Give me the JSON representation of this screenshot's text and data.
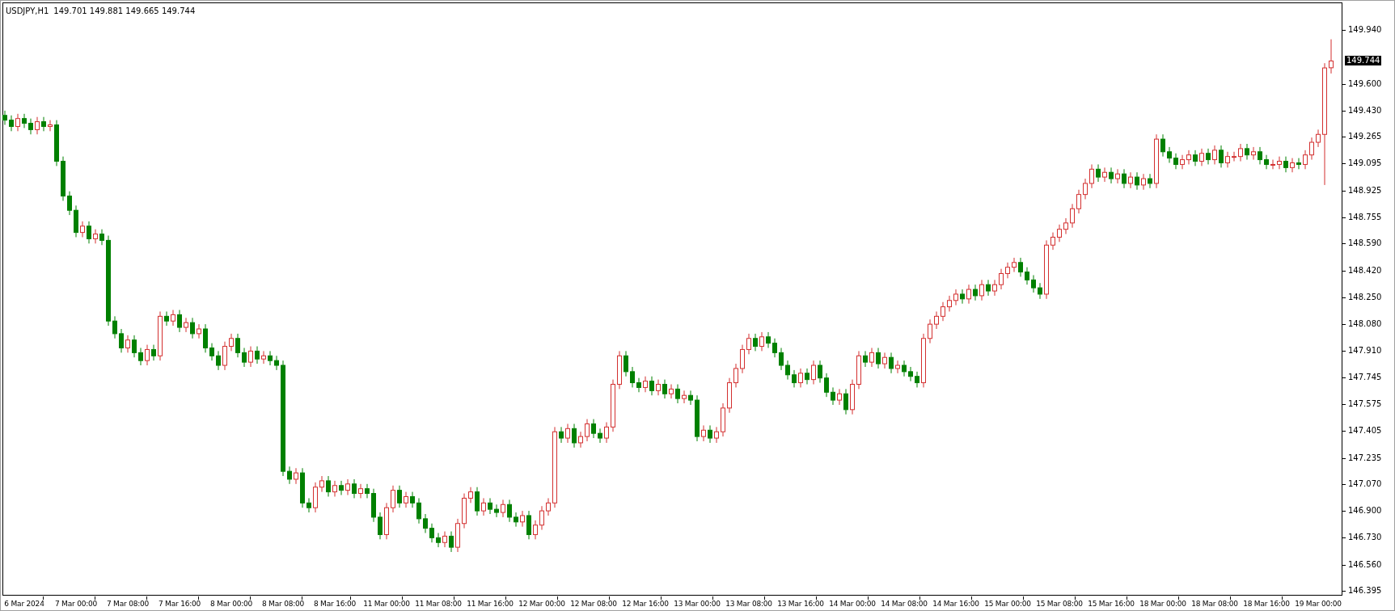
{
  "chart": {
    "header": {
      "symbol": "USDJPY,H1",
      "prices": "149.701 149.881 149.665 149.744"
    },
    "current_price": "149.744",
    "chart_data": {
      "type": "candlestick",
      "ylim": [
        146.364,
        150.109
      ],
      "yticks": [
        {
          "value": 149.94,
          "label": "149.940"
        },
        {
          "value": 149.6,
          "label": "149.600"
        },
        {
          "value": 149.43,
          "label": "149.430"
        },
        {
          "value": 149.265,
          "label": "149.265"
        },
        {
          "value": 149.095,
          "label": "149.095"
        },
        {
          "value": 148.925,
          "label": "148.925"
        },
        {
          "value": 148.755,
          "label": "148.755"
        },
        {
          "value": 148.59,
          "label": "148.590"
        },
        {
          "value": 148.42,
          "label": "148.420"
        },
        {
          "value": 148.25,
          "label": "148.250"
        },
        {
          "value": 148.08,
          "label": "148.080"
        },
        {
          "value": 147.91,
          "label": "147.910"
        },
        {
          "value": 147.745,
          "label": "147.745"
        },
        {
          "value": 147.575,
          "label": "147.575"
        },
        {
          "value": 147.405,
          "label": "147.405"
        },
        {
          "value": 147.235,
          "label": "147.235"
        },
        {
          "value": 147.07,
          "label": "147.070"
        },
        {
          "value": 146.9,
          "label": "146.900"
        },
        {
          "value": 146.73,
          "label": "146.730"
        },
        {
          "value": 146.56,
          "label": "146.560"
        },
        {
          "value": 146.395,
          "label": "146.395"
        }
      ],
      "categories": [
        null,
        null,
        null,
        "6 Mar 2024",
        null,
        null,
        null,
        null,
        null,
        null,
        null,
        "7 Mar 00:00",
        null,
        null,
        null,
        null,
        null,
        null,
        null,
        "7 Mar 08:00",
        null,
        null,
        null,
        null,
        null,
        null,
        null,
        "7 Mar 16:00",
        null,
        null,
        null,
        null,
        null,
        null,
        null,
        "8 Mar 00:00",
        null,
        null,
        null,
        null,
        null,
        null,
        null,
        "8 Mar 08:00",
        null,
        null,
        null,
        null,
        null,
        null,
        null,
        "8 Mar 16:00",
        null,
        null,
        null,
        null,
        null,
        null,
        null,
        "11 Mar 00:00",
        null,
        null,
        null,
        null,
        null,
        null,
        null,
        "11 Mar 08:00",
        null,
        null,
        null,
        null,
        null,
        null,
        null,
        "11 Mar 16:00",
        null,
        null,
        null,
        null,
        null,
        null,
        null,
        "12 Mar 00:00",
        null,
        null,
        null,
        null,
        null,
        null,
        null,
        "12 Mar 08:00",
        null,
        null,
        null,
        null,
        null,
        null,
        null,
        "12 Mar 16:00",
        null,
        null,
        null,
        null,
        null,
        null,
        null,
        "13 Mar 00:00",
        null,
        null,
        null,
        null,
        null,
        null,
        null,
        "13 Mar 08:00",
        null,
        null,
        null,
        null,
        null,
        null,
        null,
        "13 Mar 16:00",
        null,
        null,
        null,
        null,
        null,
        null,
        null,
        "14 Mar 00:00",
        null,
        null,
        null,
        null,
        null,
        null,
        null,
        "14 Mar 08:00",
        null,
        null,
        null,
        null,
        null,
        null,
        null,
        "14 Mar 16:00",
        null,
        null,
        null,
        null,
        null,
        null,
        null,
        "15 Mar 00:00",
        null,
        null,
        null,
        null,
        null,
        null,
        null,
        "15 Mar 08:00",
        null,
        null,
        null,
        null,
        null,
        null,
        null,
        "15 Mar 16:00",
        null,
        null,
        null,
        null,
        null,
        null,
        null,
        "18 Mar 00:00",
        null,
        null,
        null,
        null,
        null,
        null,
        null,
        "18 Mar 08:00",
        null,
        null,
        null,
        null,
        null,
        null,
        null,
        "18 Mar 16:00",
        null,
        null,
        null,
        null,
        null,
        null,
        null,
        "19 Mar 00:00",
        null,
        null
      ],
      "ohlc": [
        [
          149.4,
          149.43,
          149.34,
          149.37
        ],
        [
          149.37,
          149.4,
          149.3,
          149.33
        ],
        [
          149.33,
          149.41,
          149.3,
          149.38
        ],
        [
          149.38,
          149.41,
          149.32,
          149.35
        ],
        [
          149.35,
          149.38,
          149.28,
          149.31
        ],
        [
          149.31,
          149.39,
          149.28,
          149.36
        ],
        [
          149.36,
          149.39,
          149.3,
          149.33
        ],
        [
          149.33,
          149.37,
          149.3,
          149.34
        ],
        [
          149.34,
          149.37,
          149.08,
          149.11
        ],
        [
          149.11,
          149.14,
          148.86,
          148.89
        ],
        [
          148.89,
          148.92,
          148.77,
          148.8
        ],
        [
          148.8,
          148.83,
          148.63,
          148.66
        ],
        [
          148.66,
          148.73,
          148.63,
          148.7
        ],
        [
          148.7,
          148.73,
          148.59,
          148.62
        ],
        [
          148.62,
          148.68,
          148.59,
          148.65
        ],
        [
          148.65,
          148.68,
          148.58,
          148.61
        ],
        [
          148.61,
          148.64,
          148.07,
          148.1
        ],
        [
          148.1,
          148.13,
          147.99,
          148.02
        ],
        [
          148.02,
          148.05,
          147.9,
          147.93
        ],
        [
          147.93,
          148.01,
          147.9,
          147.98
        ],
        [
          147.98,
          148.01,
          147.87,
          147.9
        ],
        [
          147.9,
          147.93,
          147.82,
          147.85
        ],
        [
          147.85,
          147.95,
          147.82,
          147.92
        ],
        [
          147.92,
          147.95,
          147.85,
          147.88
        ],
        [
          147.88,
          148.16,
          147.85,
          148.13
        ],
        [
          148.13,
          148.16,
          148.07,
          148.1
        ],
        [
          148.1,
          148.17,
          148.07,
          148.14
        ],
        [
          148.14,
          148.17,
          148.03,
          148.06
        ],
        [
          148.06,
          148.12,
          148.03,
          148.09
        ],
        [
          148.09,
          148.12,
          147.99,
          148.02
        ],
        [
          148.02,
          148.08,
          147.99,
          148.05
        ],
        [
          148.05,
          148.08,
          147.9,
          147.93
        ],
        [
          147.93,
          147.96,
          147.85,
          147.88
        ],
        [
          147.88,
          147.91,
          147.79,
          147.82
        ],
        [
          147.82,
          147.97,
          147.79,
          147.94
        ],
        [
          147.94,
          148.02,
          147.91,
          147.99
        ],
        [
          147.99,
          148.02,
          147.87,
          147.9
        ],
        [
          147.9,
          147.93,
          147.81,
          147.84
        ],
        [
          147.84,
          147.94,
          147.81,
          147.91
        ],
        [
          147.91,
          147.94,
          147.83,
          147.86
        ],
        [
          147.86,
          147.91,
          147.83,
          147.88
        ],
        [
          147.88,
          147.91,
          147.82,
          147.85
        ],
        [
          147.85,
          147.88,
          147.79,
          147.82
        ],
        [
          147.82,
          147.85,
          147.12,
          147.15
        ],
        [
          147.15,
          147.18,
          147.07,
          147.1
        ],
        [
          147.1,
          147.17,
          147.07,
          147.14
        ],
        [
          147.14,
          147.17,
          146.92,
          146.95
        ],
        [
          146.95,
          146.98,
          146.89,
          146.92
        ],
        [
          146.92,
          147.08,
          146.89,
          147.05
        ],
        [
          147.05,
          147.12,
          147.02,
          147.09
        ],
        [
          147.09,
          147.12,
          146.99,
          147.02
        ],
        [
          147.02,
          147.09,
          146.99,
          147.06
        ],
        [
          147.06,
          147.09,
          147.0,
          147.03
        ],
        [
          147.03,
          147.1,
          147.0,
          147.07
        ],
        [
          147.07,
          147.1,
          146.98,
          147.01
        ],
        [
          147.01,
          147.07,
          146.98,
          147.04
        ],
        [
          147.04,
          147.07,
          146.98,
          147.01
        ],
        [
          147.01,
          147.04,
          146.83,
          146.86
        ],
        [
          146.86,
          146.89,
          146.72,
          146.75
        ],
        [
          146.75,
          146.95,
          146.72,
          146.92
        ],
        [
          146.92,
          147.06,
          146.89,
          147.03
        ],
        [
          147.03,
          147.06,
          146.92,
          146.95
        ],
        [
          146.95,
          147.02,
          146.92,
          146.99
        ],
        [
          146.99,
          147.02,
          146.92,
          146.95
        ],
        [
          146.95,
          146.98,
          146.82,
          146.85
        ],
        [
          146.85,
          146.88,
          146.76,
          146.79
        ],
        [
          146.79,
          146.82,
          146.7,
          146.73
        ],
        [
          146.73,
          146.76,
          146.67,
          146.7
        ],
        [
          146.7,
          146.77,
          146.67,
          146.74
        ],
        [
          146.74,
          146.77,
          146.64,
          146.67
        ],
        [
          146.67,
          146.85,
          146.64,
          146.82
        ],
        [
          146.82,
          147.01,
          146.79,
          146.98
        ],
        [
          146.98,
          147.05,
          146.95,
          147.02
        ],
        [
          147.02,
          147.05,
          146.87,
          146.9
        ],
        [
          146.9,
          146.98,
          146.87,
          146.95
        ],
        [
          146.95,
          146.98,
          146.88,
          146.91
        ],
        [
          146.91,
          146.94,
          146.86,
          146.89
        ],
        [
          146.89,
          146.97,
          146.86,
          146.94
        ],
        [
          146.94,
          146.97,
          146.83,
          146.86
        ],
        [
          146.86,
          146.89,
          146.8,
          146.83
        ],
        [
          146.83,
          146.9,
          146.8,
          146.87
        ],
        [
          146.87,
          146.9,
          146.72,
          146.75
        ],
        [
          146.75,
          146.84,
          146.72,
          146.81
        ],
        [
          146.81,
          146.93,
          146.78,
          146.9
        ],
        [
          146.9,
          146.98,
          146.87,
          146.95
        ],
        [
          146.95,
          147.43,
          146.92,
          147.4
        ],
        [
          147.4,
          147.43,
          147.33,
          147.36
        ],
        [
          147.36,
          147.45,
          147.33,
          147.42
        ],
        [
          147.42,
          147.45,
          147.3,
          147.33
        ],
        [
          147.33,
          147.4,
          147.3,
          147.37
        ],
        [
          147.37,
          147.48,
          147.34,
          147.45
        ],
        [
          147.45,
          147.48,
          147.36,
          147.39
        ],
        [
          147.39,
          147.42,
          147.33,
          147.36
        ],
        [
          147.36,
          147.46,
          147.33,
          147.43
        ],
        [
          147.43,
          147.73,
          147.4,
          147.7
        ],
        [
          147.7,
          147.91,
          147.67,
          147.88
        ],
        [
          147.88,
          147.91,
          147.75,
          147.78
        ],
        [
          147.78,
          147.81,
          147.68,
          147.71
        ],
        [
          147.71,
          147.74,
          147.65,
          147.68
        ],
        [
          147.68,
          147.75,
          147.65,
          147.72
        ],
        [
          147.72,
          147.75,
          147.63,
          147.66
        ],
        [
          147.66,
          147.73,
          147.63,
          147.7
        ],
        [
          147.7,
          147.73,
          147.61,
          147.64
        ],
        [
          147.64,
          147.7,
          147.61,
          147.67
        ],
        [
          147.67,
          147.7,
          147.58,
          147.61
        ],
        [
          147.61,
          147.66,
          147.58,
          147.63
        ],
        [
          147.63,
          147.66,
          147.57,
          147.6
        ],
        [
          147.6,
          147.63,
          147.34,
          147.37
        ],
        [
          147.37,
          147.44,
          147.34,
          147.41
        ],
        [
          147.41,
          147.44,
          147.33,
          147.36
        ],
        [
          147.36,
          147.43,
          147.33,
          147.4
        ],
        [
          147.4,
          147.58,
          147.37,
          147.55
        ],
        [
          147.55,
          147.74,
          147.52,
          147.71
        ],
        [
          147.71,
          147.83,
          147.68,
          147.8
        ],
        [
          147.8,
          147.95,
          147.77,
          147.92
        ],
        [
          147.92,
          148.02,
          147.89,
          147.99
        ],
        [
          147.99,
          148.02,
          147.91,
          147.94
        ],
        [
          147.94,
          148.03,
          147.91,
          148.0
        ],
        [
          148.0,
          148.03,
          147.93,
          147.96
        ],
        [
          147.96,
          147.99,
          147.87,
          147.9
        ],
        [
          147.9,
          147.93,
          147.79,
          147.82
        ],
        [
          147.82,
          147.85,
          147.73,
          147.76
        ],
        [
          147.76,
          147.79,
          147.68,
          147.71
        ],
        [
          147.71,
          147.8,
          147.68,
          147.77
        ],
        [
          147.77,
          147.8,
          147.7,
          147.73
        ],
        [
          147.73,
          147.85,
          147.7,
          147.82
        ],
        [
          147.82,
          147.85,
          147.71,
          147.74
        ],
        [
          147.74,
          147.77,
          147.62,
          147.65
        ],
        [
          147.65,
          147.68,
          147.57,
          147.6
        ],
        [
          147.6,
          147.67,
          147.57,
          147.64
        ],
        [
          147.64,
          147.67,
          147.51,
          147.54
        ],
        [
          147.54,
          147.73,
          147.51,
          147.7
        ],
        [
          147.7,
          147.91,
          147.67,
          147.88
        ],
        [
          147.88,
          147.91,
          147.81,
          147.84
        ],
        [
          147.84,
          147.93,
          147.81,
          147.9
        ],
        [
          147.9,
          147.93,
          147.8,
          147.83
        ],
        [
          147.83,
          147.9,
          147.8,
          147.87
        ],
        [
          147.87,
          147.9,
          147.77,
          147.8
        ],
        [
          147.8,
          147.85,
          147.77,
          147.82
        ],
        [
          147.82,
          147.85,
          147.75,
          147.78
        ],
        [
          147.78,
          147.81,
          147.72,
          147.75
        ],
        [
          147.75,
          147.78,
          147.68,
          147.71
        ],
        [
          147.71,
          148.02,
          147.68,
          147.99
        ],
        [
          147.99,
          148.11,
          147.96,
          148.08
        ],
        [
          148.08,
          148.16,
          148.05,
          148.13
        ],
        [
          148.13,
          148.22,
          148.1,
          148.19
        ],
        [
          148.19,
          148.26,
          148.16,
          148.23
        ],
        [
          148.23,
          148.3,
          148.2,
          148.27
        ],
        [
          148.27,
          148.3,
          148.21,
          148.24
        ],
        [
          148.24,
          148.33,
          148.21,
          148.3
        ],
        [
          148.3,
          148.33,
          148.23,
          148.26
        ],
        [
          148.26,
          148.36,
          148.23,
          148.33
        ],
        [
          148.33,
          148.36,
          148.26,
          148.29
        ],
        [
          148.29,
          148.36,
          148.26,
          148.33
        ],
        [
          148.33,
          148.43,
          148.3,
          148.4
        ],
        [
          148.4,
          148.47,
          148.37,
          148.44
        ],
        [
          148.44,
          148.5,
          148.41,
          148.47
        ],
        [
          148.47,
          148.5,
          148.38,
          148.41
        ],
        [
          148.41,
          148.44,
          148.33,
          148.36
        ],
        [
          148.36,
          148.39,
          148.28,
          148.31
        ],
        [
          148.31,
          148.34,
          148.24,
          148.27
        ],
        [
          148.27,
          148.61,
          148.24,
          148.58
        ],
        [
          148.58,
          148.66,
          148.55,
          148.63
        ],
        [
          148.63,
          148.71,
          148.6,
          148.68
        ],
        [
          148.68,
          148.75,
          148.65,
          148.72
        ],
        [
          148.72,
          148.84,
          148.69,
          148.81
        ],
        [
          148.81,
          148.93,
          148.78,
          148.9
        ],
        [
          148.9,
          149.0,
          148.87,
          148.97
        ],
        [
          148.97,
          149.09,
          148.94,
          149.06
        ],
        [
          149.06,
          149.09,
          148.98,
          149.01
        ],
        [
          149.01,
          149.07,
          148.98,
          149.04
        ],
        [
          149.04,
          149.07,
          148.97,
          149.0
        ],
        [
          149.0,
          149.06,
          148.97,
          149.03
        ],
        [
          149.03,
          149.06,
          148.94,
          148.97
        ],
        [
          148.97,
          149.04,
          148.94,
          149.01
        ],
        [
          149.01,
          149.04,
          148.93,
          148.96
        ],
        [
          148.96,
          149.03,
          148.93,
          149.0
        ],
        [
          149.0,
          149.03,
          148.94,
          148.97
        ],
        [
          148.97,
          149.28,
          148.94,
          149.25
        ],
        [
          149.25,
          149.28,
          149.14,
          149.17
        ],
        [
          149.17,
          149.2,
          149.1,
          149.13
        ],
        [
          149.13,
          149.16,
          149.06,
          149.09
        ],
        [
          149.09,
          149.15,
          149.06,
          149.12
        ],
        [
          149.12,
          149.18,
          149.09,
          149.15
        ],
        [
          149.15,
          149.18,
          149.08,
          149.11
        ],
        [
          149.11,
          149.19,
          149.08,
          149.16
        ],
        [
          149.16,
          149.19,
          149.09,
          149.12
        ],
        [
          149.12,
          149.21,
          149.09,
          149.18
        ],
        [
          149.18,
          149.21,
          149.07,
          149.1
        ],
        [
          149.1,
          149.17,
          149.07,
          149.14
        ],
        [
          149.14,
          149.17,
          149.11,
          149.14
        ],
        [
          149.14,
          149.22,
          149.11,
          149.19
        ],
        [
          149.19,
          149.22,
          149.12,
          149.15
        ],
        [
          149.15,
          149.2,
          149.12,
          149.17
        ],
        [
          149.17,
          149.2,
          149.09,
          149.12
        ],
        [
          149.12,
          149.15,
          149.06,
          149.09
        ],
        [
          149.09,
          149.12,
          149.06,
          149.09
        ],
        [
          149.09,
          149.14,
          149.06,
          149.11
        ],
        [
          149.11,
          149.14,
          149.04,
          149.07
        ],
        [
          149.07,
          149.13,
          149.04,
          149.1
        ],
        [
          149.1,
          149.13,
          149.06,
          149.09
        ],
        [
          149.09,
          149.18,
          149.06,
          149.15
        ],
        [
          149.15,
          149.26,
          149.12,
          149.23
        ],
        [
          149.23,
          149.31,
          149.2,
          149.28
        ],
        [
          149.28,
          149.73,
          148.96,
          149.7
        ],
        [
          149.701,
          149.881,
          149.665,
          149.744
        ]
      ]
    }
  }
}
